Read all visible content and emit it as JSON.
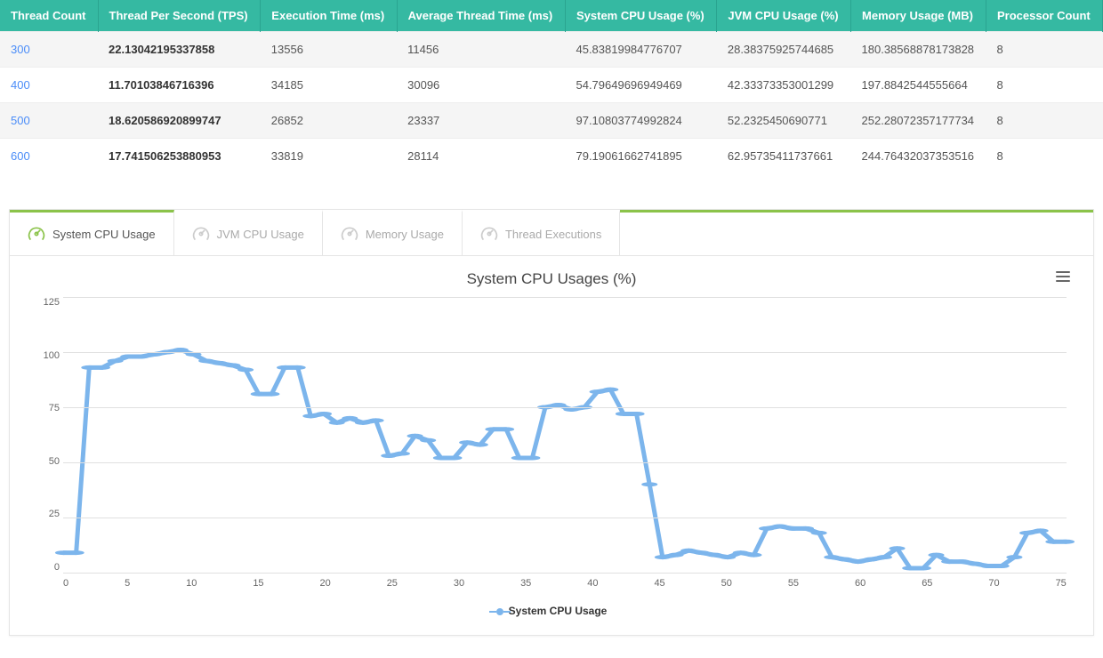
{
  "table": {
    "headers": [
      "Thread Count",
      "Thread Per Second (TPS)",
      "Execution Time (ms)",
      "Average Thread Time (ms)",
      "System CPU Usage (%)",
      "JVM CPU Usage (%)",
      "Memory Usage (MB)",
      "Processor Count"
    ],
    "rows": [
      {
        "thread_count": "300",
        "tps": "22.13042195337858",
        "exec": "13556",
        "avg": "11456",
        "sys": "45.83819984776707",
        "jvm": "28.38375925744685",
        "mem": "180.38568878173828",
        "proc": "8"
      },
      {
        "thread_count": "400",
        "tps": "11.70103846716396",
        "exec": "34185",
        "avg": "30096",
        "sys": "54.79649696949469",
        "jvm": "42.33373353001299",
        "mem": "197.8842544555664",
        "proc": "8"
      },
      {
        "thread_count": "500",
        "tps": "18.620586920899747",
        "exec": "26852",
        "avg": "23337",
        "sys": "97.10803774992824",
        "jvm": "52.2325450690771",
        "mem": "252.28072357177734",
        "proc": "8"
      },
      {
        "thread_count": "600",
        "tps": "17.741506253880953",
        "exec": "33819",
        "avg": "28114",
        "sys": "79.19061662741895",
        "jvm": "62.95735411737661",
        "mem": "244.76432037353516",
        "proc": "8"
      }
    ]
  },
  "tabs": [
    "System CPU Usage",
    "JVM CPU Usage",
    "Memory Usage",
    "Thread Executions"
  ],
  "tabs_active_index": 0,
  "chart_title": "System CPU Usages (%)",
  "legend_label": "System CPU Usage",
  "chart_data": {
    "type": "line",
    "title": "System CPU Usages (%)",
    "xlabel": "",
    "ylabel": "",
    "ylim": [
      0,
      125
    ],
    "yticks": [
      0,
      25,
      50,
      75,
      100,
      125
    ],
    "xticks": [
      0,
      5,
      10,
      15,
      20,
      25,
      30,
      35,
      40,
      45,
      50,
      55,
      60,
      65,
      70,
      75
    ],
    "series": [
      {
        "name": "System CPU Usage",
        "color": "#7cb5ec",
        "x": [
          0,
          1,
          2,
          3,
          4,
          5,
          6,
          7,
          8,
          9,
          10,
          11,
          12,
          13,
          14,
          15,
          16,
          17,
          18,
          19,
          20,
          21,
          22,
          23,
          24,
          25,
          26,
          27,
          28,
          29,
          30,
          31,
          32,
          33,
          34,
          35,
          36,
          37,
          38,
          39,
          40,
          41,
          42,
          43,
          44,
          45,
          46,
          47,
          48,
          49,
          50,
          51,
          52,
          53,
          54,
          55,
          56,
          57,
          58,
          59,
          60,
          61,
          62,
          63,
          64,
          65,
          66,
          67,
          68,
          69,
          70,
          71,
          72,
          73,
          74,
          75,
          76,
          77
        ],
        "values": [
          9,
          9,
          93,
          93,
          96,
          98,
          98,
          99,
          100,
          101,
          99,
          96,
          95,
          94,
          92,
          81,
          81,
          93,
          93,
          71,
          72,
          68,
          70,
          68,
          69,
          53,
          54,
          62,
          60,
          52,
          52,
          59,
          58,
          65,
          65,
          52,
          52,
          75,
          76,
          74,
          75,
          82,
          83,
          72,
          72,
          40,
          7,
          8,
          10,
          9,
          8,
          7,
          9,
          8,
          20,
          21,
          20,
          20,
          18,
          7,
          6,
          5,
          6,
          7,
          11,
          2,
          2,
          8,
          5,
          5,
          4,
          3,
          3,
          7,
          18,
          19,
          14,
          14
        ]
      }
    ]
  }
}
